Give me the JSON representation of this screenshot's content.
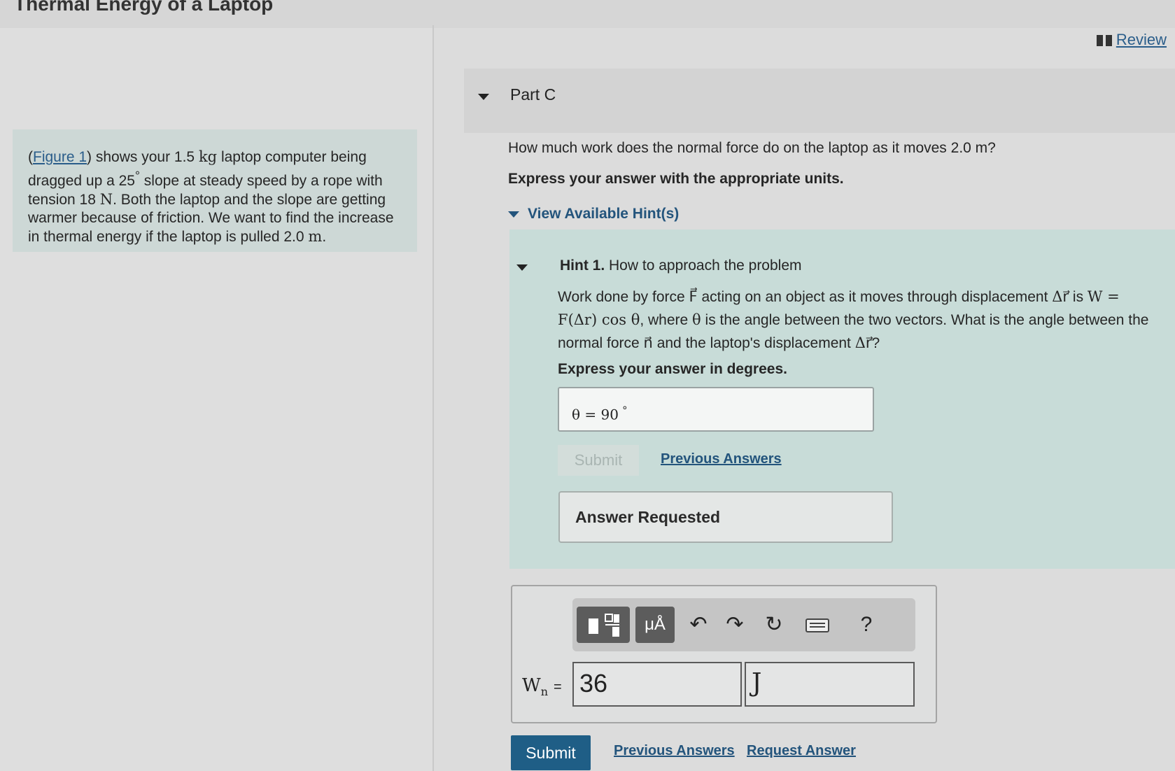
{
  "page": {
    "title": "Thermal Energy of a Laptop"
  },
  "problem": {
    "figure_link": "Figure 1",
    "text_1": ") shows your 1.5 ",
    "kg": "kg",
    "text_2": " laptop computer being dragged up a 25",
    "deg": "°",
    "text_3": " slope at steady speed by a rope with tension 18 ",
    "newton": "N",
    "text_4": ". Both the laptop and the slope are getting warmer because of friction. We want to find the increase in thermal energy if the laptop is pulled 2.0 ",
    "meter": "m",
    "text_5": "."
  },
  "review": {
    "label": "Review"
  },
  "part": {
    "label": "Part C"
  },
  "question": {
    "text": "How much work does the normal force do on the laptop as it moves 2.0 m?"
  },
  "express": {
    "text": "Express your answer with the appropriate units."
  },
  "hints": {
    "toggle_label": "View Available Hint(s)",
    "hint1": {
      "number": "Hint 1.",
      "title": "How to approach the problem",
      "body_1": "Work done by force ",
      "body_2": " acting on an object as it moves through displacement ",
      "body_3": " is ",
      "formula": "W = F(Δr) cos θ",
      "body_4": ", where ",
      "theta": "θ",
      "body_5": " is the angle between the two vectors. What is the angle between the normal force ",
      "body_6": " and the laptop's displacement ",
      "body_7": "?",
      "vec_F": "F⃗",
      "vec_r": "Δr⃗",
      "vec_n": "n⃗",
      "express": "Express your answer in degrees.",
      "answer_label": "θ = 90",
      "answer_unit": "°",
      "submit_label": "Submit",
      "previous_answers": "Previous Answers",
      "status": "Answer Requested"
    }
  },
  "toolbar": {
    "templates_icon": "template-icon",
    "units_label": "μÅ",
    "undo": "↶",
    "redo": "↷",
    "reset": "↻",
    "keyboard_icon": "keyboard-icon",
    "help": "?"
  },
  "answer": {
    "label_main": "W",
    "label_sub": "n",
    "equals": "=",
    "value": "36",
    "unit": "J"
  },
  "actions": {
    "submit": "Submit",
    "previous_answers": "Previous Answers",
    "request_answer": "Request Answer"
  },
  "colors": {
    "primary": "#1f5e86",
    "link": "#23547c",
    "hint_panel": "#c8dcd8",
    "problem_box": "#cdd8d6"
  }
}
